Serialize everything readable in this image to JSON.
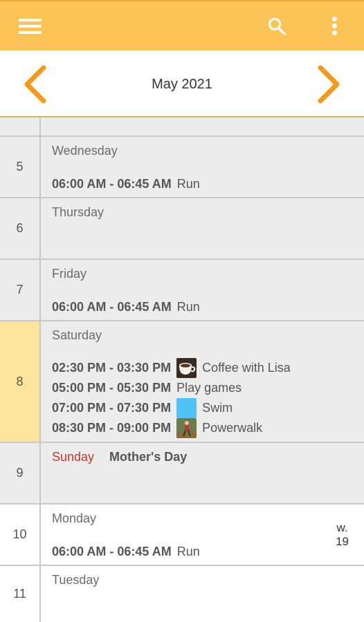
{
  "toolbar": {
    "menu_icon": "menu-icon",
    "search_icon": "search-icon",
    "more_icon": "more-vertical-icon",
    "background": "#fcc457"
  },
  "month_bar": {
    "title": "May 2021",
    "prev_icon": "chevron-left-icon",
    "next_icon": "chevron-right-icon",
    "arrow_color": "#f29a1f"
  },
  "days": [
    {
      "date": "5",
      "weekday": "Wednesday",
      "events": [
        {
          "time": "06:00 AM - 06:45 AM",
          "title": "Run",
          "icon": ""
        }
      ]
    },
    {
      "date": "6",
      "weekday": "Thursday",
      "events": []
    },
    {
      "date": "7",
      "weekday": "Friday",
      "events": [
        {
          "time": "06:00 AM - 06:45 AM",
          "title": "Run",
          "icon": ""
        }
      ]
    },
    {
      "date": "8",
      "weekday": "Saturday",
      "today": true,
      "events": [
        {
          "time": "02:30 PM - 03:30 PM",
          "title": "Coffee with Lisa",
          "icon": "coffee-cup-icon"
        },
        {
          "time": "05:00 PM - 05:30 PM",
          "title": "Play games",
          "icon": ""
        },
        {
          "time": "07:00 PM - 07:30 PM",
          "title": "Swim",
          "icon": "swim-icon"
        },
        {
          "time": "08:30 PM - 09:00 PM",
          "title": "Powerwalk",
          "icon": "powerwalk-icon"
        }
      ]
    },
    {
      "date": "9",
      "weekday": "Sunday",
      "holiday": "Mother's Day",
      "events": []
    },
    {
      "date": "10",
      "weekday": "Monday",
      "week_label_prefix": "w.",
      "week_number": "19",
      "events": [
        {
          "time": "06:00 AM - 06:45 AM",
          "title": "Run",
          "icon": ""
        }
      ]
    },
    {
      "date": "11",
      "weekday": "Tuesday",
      "events": []
    }
  ]
}
